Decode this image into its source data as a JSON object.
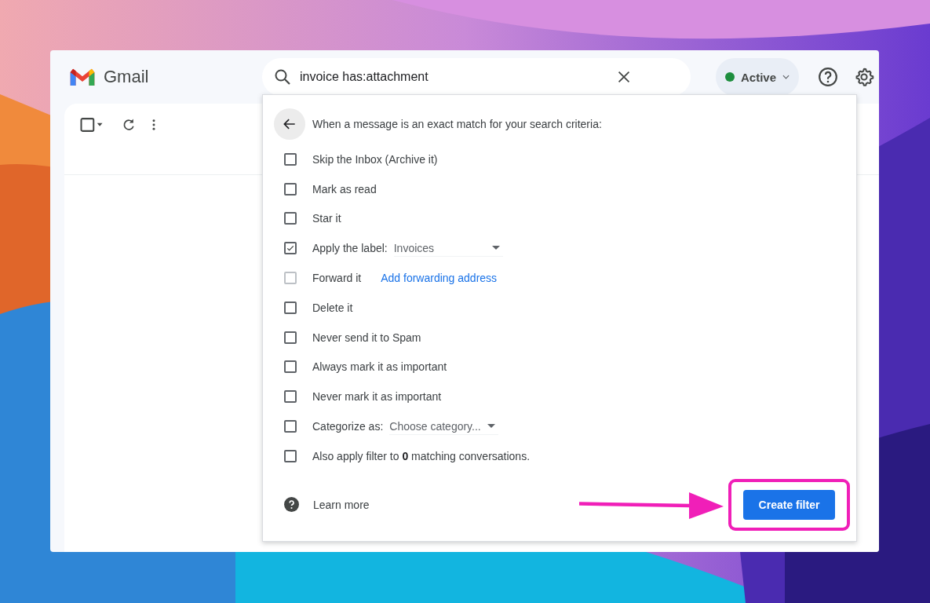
{
  "header": {
    "app_name": "Gmail"
  },
  "search": {
    "value": "invoice has:attachment"
  },
  "status": {
    "label": "Active",
    "color": "#1e8e3e"
  },
  "filter_panel": {
    "heading": "When a message is an exact match for your search criteria:",
    "options": [
      {
        "kind": "plain",
        "label": "Skip the Inbox (Archive it)",
        "checked": false,
        "disabled": false
      },
      {
        "kind": "plain",
        "label": "Mark as read",
        "checked": false,
        "disabled": false
      },
      {
        "kind": "plain",
        "label": "Star it",
        "checked": false,
        "disabled": false
      },
      {
        "kind": "select",
        "label": "Apply the label:",
        "value": "Invoices",
        "checked": true,
        "disabled": false
      },
      {
        "kind": "link",
        "label": "Forward it",
        "link": "Add forwarding address",
        "checked": false,
        "disabled": true
      },
      {
        "kind": "plain",
        "label": "Delete it",
        "checked": false,
        "disabled": false
      },
      {
        "kind": "plain",
        "label": "Never send it to Spam",
        "checked": false,
        "disabled": false
      },
      {
        "kind": "plain",
        "label": "Always mark it as important",
        "checked": false,
        "disabled": false
      },
      {
        "kind": "plain",
        "label": "Never mark it as important",
        "checked": false,
        "disabled": false
      },
      {
        "kind": "select",
        "label": "Categorize as:",
        "value": "Choose category...",
        "checked": false,
        "disabled": false
      },
      {
        "kind": "rich",
        "label": "Also apply filter to **0** matching conversations.",
        "checked": false,
        "disabled": false
      }
    ],
    "learn_more": "Learn more",
    "create_button": "Create filter",
    "highlighted": true
  }
}
